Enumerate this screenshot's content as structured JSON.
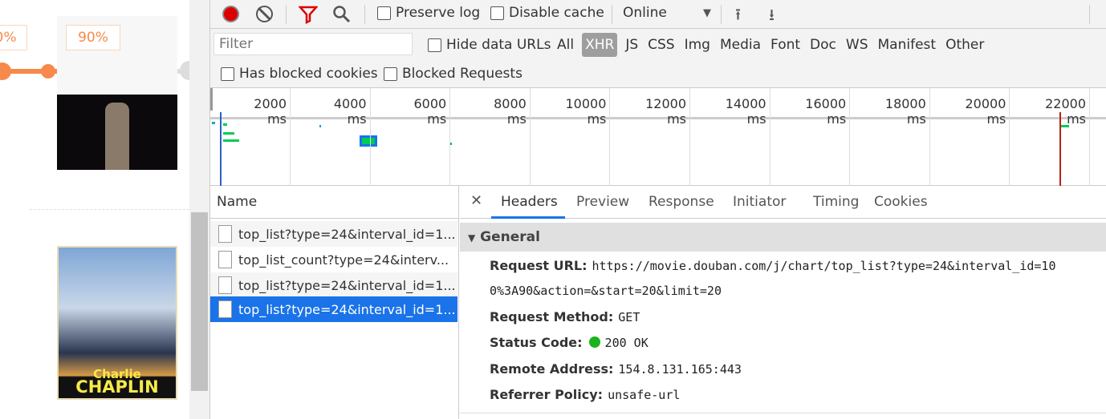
{
  "page": {
    "badge_left": "0%",
    "badge_right": "90%",
    "accent": "#f7894b"
  },
  "toolbar": {
    "preserve_log": "Preserve log",
    "disable_cache": "Disable cache",
    "throttle": "Online",
    "icons": [
      "record-icon",
      "clear-icon",
      "filter-icon",
      "search-icon",
      "upload-icon",
      "download-icon"
    ]
  },
  "filter": {
    "placeholder": "Filter",
    "hide_data_urls": "Hide data URLs",
    "types": [
      "All",
      "XHR",
      "JS",
      "CSS",
      "Img",
      "Media",
      "Font",
      "Doc",
      "WS",
      "Manifest",
      "Other"
    ],
    "active": "XHR"
  },
  "blocked": {
    "has_blocked_cookies": "Has blocked cookies",
    "blocked_requests": "Blocked Requests"
  },
  "timeline": {
    "ticks": [
      "2000 ms",
      "4000 ms",
      "6000 ms",
      "8000 ms",
      "10000 ms",
      "12000 ms",
      "14000 ms",
      "16000 ms",
      "18000 ms",
      "20000 ms",
      "22000 ms"
    ]
  },
  "requests": {
    "header": "Name",
    "items": [
      "top_list?type=24&interval_id=1...",
      "top_list_count?type=24&interv...",
      "top_list?type=24&interval_id=1...",
      "top_list?type=24&interval_id=1..."
    ],
    "selected": 3
  },
  "details": {
    "tabs": [
      "Headers",
      "Preview",
      "Response",
      "Initiator",
      "Timing",
      "Cookies"
    ],
    "active": "Headers",
    "section": "General",
    "request_url_label": "Request URL:",
    "request_url_1": "https://movie.douban.com/j/chart/top_list?type=24&interval_id=10",
    "request_url_2": "0%3A90&action=&start=20&limit=20",
    "method_label": "Request Method:",
    "method": "GET",
    "status_label": "Status Code:",
    "status": "200 OK",
    "status_color": "#1a9e1a",
    "remote_label": "Remote Address:",
    "remote": "154.8.131.165:443",
    "referrer_label": "Referrer Policy:",
    "referrer": "unsafe-url"
  }
}
